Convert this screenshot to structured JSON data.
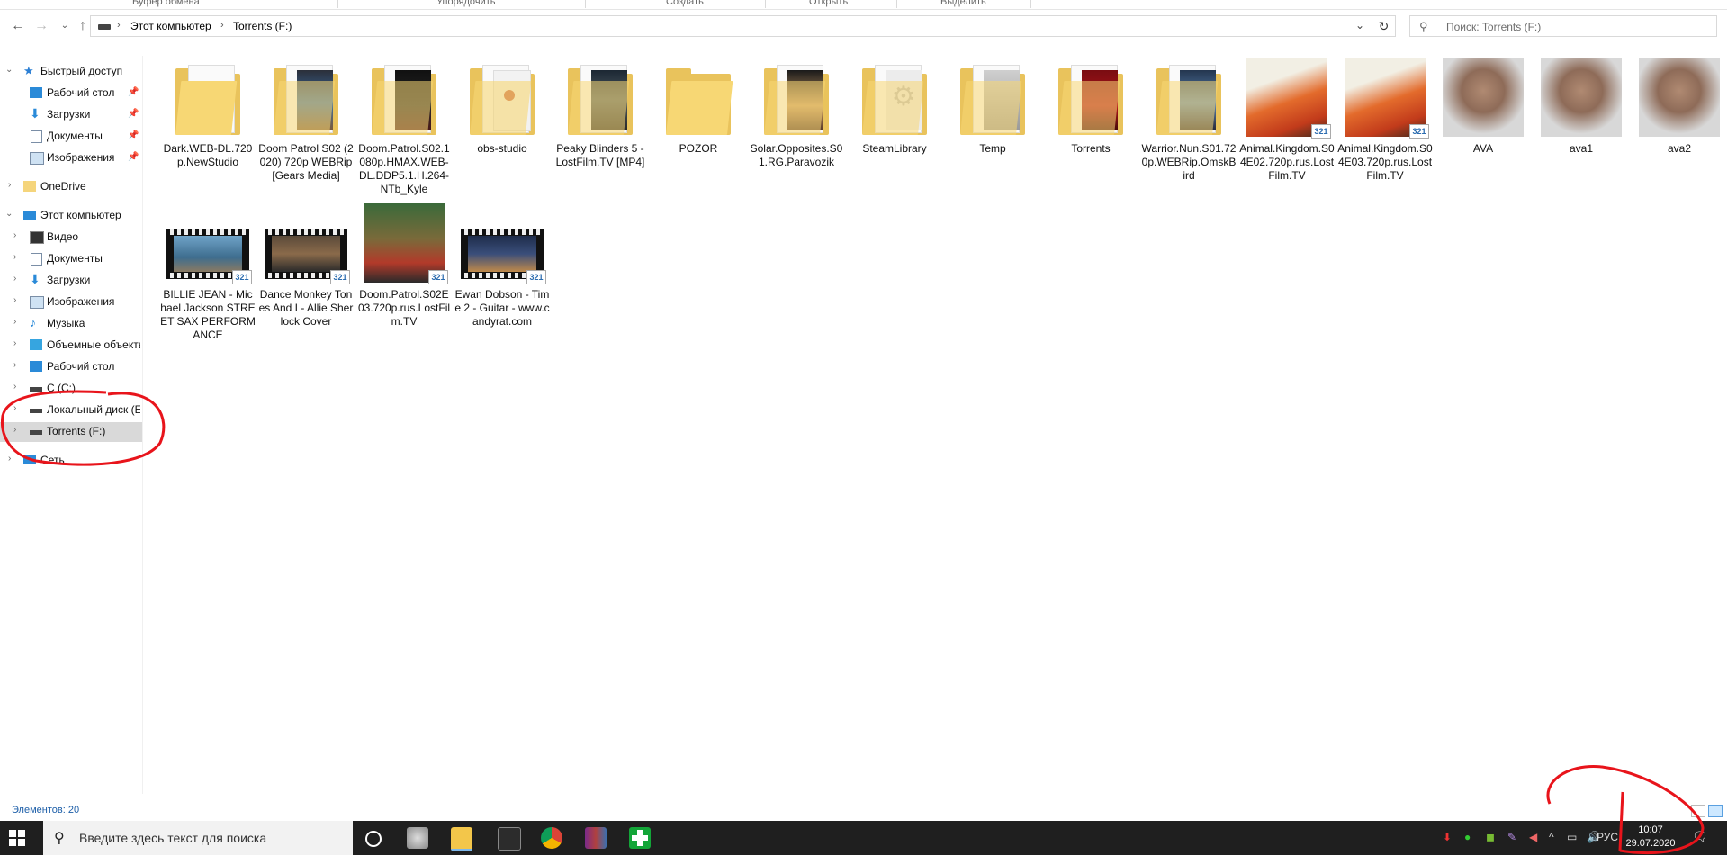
{
  "ribbon": {
    "groups": [
      "Буфер обмена",
      "Упорядочить",
      "Создать",
      "Открыть",
      "Выделить"
    ]
  },
  "address": {
    "crumbs": [
      "Этот компьютер",
      "Torrents (F:)"
    ],
    "search_placeholder": "Поиск: Torrents (F:)"
  },
  "sidebar": {
    "quick_access": "Быстрый доступ",
    "quick_items": [
      "Рабочий стол",
      "Загрузки",
      "Документы",
      "Изображения"
    ],
    "onedrive": "OneDrive",
    "this_pc": "Этот компьютер",
    "pc_items": [
      "Видео",
      "Документы",
      "Загрузки",
      "Изображения",
      "Музыка",
      "Объемные объекты",
      "Рабочий стол",
      "C (C:)",
      "Локальный диск (E",
      "Torrents (F:)"
    ],
    "network": "Сеть"
  },
  "files": [
    {
      "name": "Dark.WEB-DL.720p.NewStudio",
      "kind": "folder"
    },
    {
      "name": "Doom Patrol S02 (2020) 720p WEBRip [Gears Media]",
      "kind": "folder"
    },
    {
      "name": "Doom.Patrol.S02.1080p.HMAX.WEB-DL.DDP5.1.H.264-NTb_Kyle",
      "kind": "folder"
    },
    {
      "name": "obs-studio",
      "kind": "folder"
    },
    {
      "name": "Peaky Blinders 5 - LostFilm.TV [MP4]",
      "kind": "folder"
    },
    {
      "name": "POZOR",
      "kind": "folder"
    },
    {
      "name": "Solar.Opposites.S01.RG.Paravozik",
      "kind": "folder"
    },
    {
      "name": "SteamLibrary",
      "kind": "folder"
    },
    {
      "name": "Temp",
      "kind": "folder"
    },
    {
      "name": "Torrents",
      "kind": "folder"
    },
    {
      "name": "Warrior.Nun.S01.720p.WEBRip.OmskBird",
      "kind": "folder"
    },
    {
      "name": "Animal.Kingdom.S04E02.720p.rus.LostFilm.TV",
      "kind": "video"
    },
    {
      "name": "Animal.Kingdom.S04E03.720p.rus.LostFilm.TV",
      "kind": "video"
    },
    {
      "name": "AVA",
      "kind": "image"
    },
    {
      "name": "ava1",
      "kind": "image"
    },
    {
      "name": "ava2",
      "kind": "image"
    },
    {
      "name": "BILLIE JEAN - Michael Jackson STREET SAX PERFORMANCE",
      "kind": "film"
    },
    {
      "name": "Dance Monkey Tones And I - Allie Sherlock Cover",
      "kind": "film"
    },
    {
      "name": "Doom.Patrol.S02E03.720p.rus.LostFilm.TV",
      "kind": "video"
    },
    {
      "name": "Ewan Dobson - Time 2 - Guitar - www.candyrat.com",
      "kind": "film"
    }
  ],
  "badge_text": "321",
  "status": {
    "count": "Элементов: 20"
  },
  "taskbar": {
    "search_placeholder": "Введите здесь текст для поиска",
    "lang": "РУС",
    "time": "10:07",
    "date": "29.07.2020"
  },
  "colors": {
    "folder": "#f7d774",
    "taskbar": "#1f1f1f",
    "annotation": "#e8141b"
  }
}
